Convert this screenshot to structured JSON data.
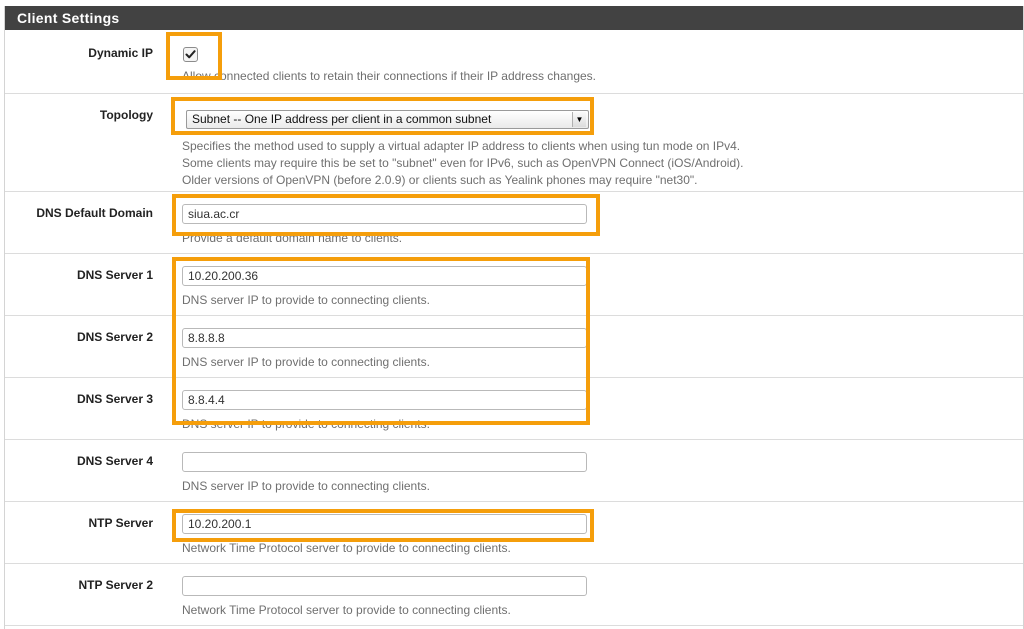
{
  "panel": {
    "title": "Client Settings"
  },
  "dynamic_ip": {
    "label": "Dynamic IP",
    "checked": true,
    "help": "Allow connected clients to retain their connections if their IP address changes."
  },
  "topology": {
    "label": "Topology",
    "selected": "Subnet -- One IP address per client in a common subnet",
    "help_lines": [
      "Specifies the method used to supply a virtual adapter IP address to clients when using tun mode on IPv4.",
      "Some clients may require this be set to \"subnet\" even for IPv6, such as OpenVPN Connect (iOS/Android).",
      "Older versions of OpenVPN (before 2.0.9) or clients such as Yealink phones may require \"net30\"."
    ]
  },
  "dns_domain": {
    "label": "DNS Default Domain",
    "value": "siua.ac.cr",
    "help": "Provide a default domain name to clients."
  },
  "dns_servers": [
    {
      "label": "DNS Server 1",
      "value": "10.20.200.36",
      "help": "DNS server IP to provide to connecting clients."
    },
    {
      "label": "DNS Server 2",
      "value": "8.8.8.8",
      "help": "DNS server IP to provide to connecting clients."
    },
    {
      "label": "DNS Server 3",
      "value": "8.8.4.4",
      "help": "DNS server IP to provide to connecting clients."
    },
    {
      "label": "DNS Server 4",
      "value": "",
      "help": "DNS server IP to provide to connecting clients."
    }
  ],
  "ntp_servers": [
    {
      "label": "NTP Server",
      "value": "10.20.200.1",
      "help": "Network Time Protocol server to provide to connecting clients."
    },
    {
      "label": "NTP Server 2",
      "value": "",
      "help": "Network Time Protocol server to provide to connecting clients."
    }
  ],
  "colors": {
    "highlight": "#f59e0b",
    "heading_bg": "#424242",
    "heading_text": "#ffffff",
    "help_text": "#6f6f6f"
  },
  "icons": {
    "checkmark": "check-icon",
    "dropdown": "chevron-down-icon"
  }
}
